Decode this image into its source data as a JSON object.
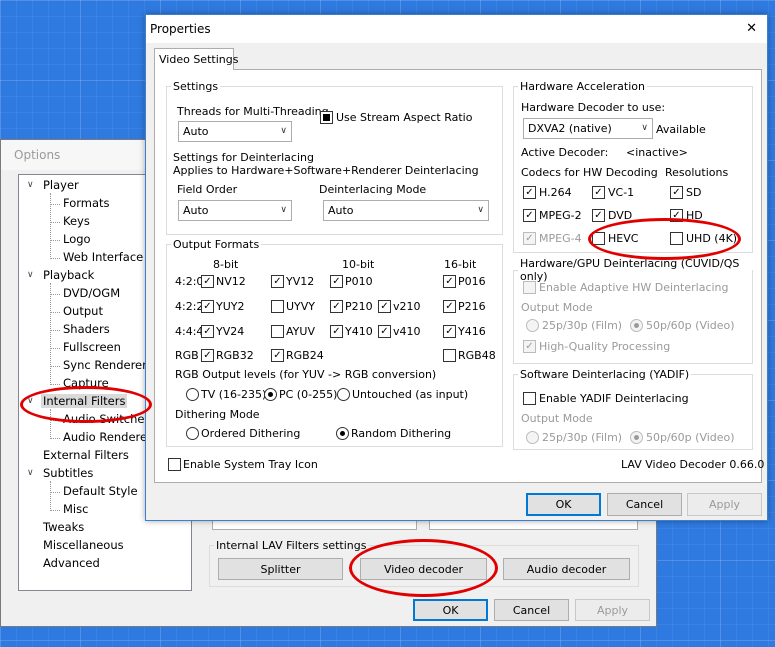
{
  "options": {
    "title": "Options",
    "tree": [
      {
        "label": "Player",
        "level": 0,
        "toggle": "∨"
      },
      {
        "label": "Formats",
        "level": 1
      },
      {
        "label": "Keys",
        "level": 1
      },
      {
        "label": "Logo",
        "level": 1
      },
      {
        "label": "Web Interface",
        "level": 1
      },
      {
        "label": "Playback",
        "level": 0,
        "toggle": "∨"
      },
      {
        "label": "DVD/OGM",
        "level": 1
      },
      {
        "label": "Output",
        "level": 1
      },
      {
        "label": "Shaders",
        "level": 1
      },
      {
        "label": "Fullscreen",
        "level": 1
      },
      {
        "label": "Sync Renderer S",
        "level": 1
      },
      {
        "label": "Capture",
        "level": 1
      },
      {
        "label": "Internal Filters",
        "level": 0,
        "toggle": "∨",
        "selected": true
      },
      {
        "label": "Audio Switcher",
        "level": 1
      },
      {
        "label": "Audio Renderer",
        "level": 1
      },
      {
        "label": "External Filters",
        "level": 0
      },
      {
        "label": "Subtitles",
        "level": 0,
        "toggle": "∨"
      },
      {
        "label": "Default Style",
        "level": 1
      },
      {
        "label": "Misc",
        "level": 1
      },
      {
        "label": "Tweaks",
        "level": 0
      },
      {
        "label": "Miscellaneous",
        "level": 0
      },
      {
        "label": "Advanced",
        "level": 0
      }
    ],
    "lav_group": "Internal LAV Filters settings",
    "splitter_label": "Splitter",
    "video_decoder_label": "Video decoder",
    "audio_decoder_label": "Audio decoder",
    "ok_label": "OK",
    "cancel_label": "Cancel",
    "apply_label": "Apply"
  },
  "props": {
    "title": "Properties",
    "close_glyph": "✕",
    "tab_label": "Video Settings",
    "settings": {
      "legend": "Settings",
      "threads_label": "Threads for Multi-Threading",
      "threads_value": "Auto",
      "stream_aspect_label": "Use Stream Aspect Ratio",
      "deint_line1": "Settings for Deinterlacing",
      "deint_line2": "Applies to Hardware+Software+Renderer Deinterlacing",
      "field_order_label": "Field Order",
      "field_order_value": "Auto",
      "deint_mode_label": "Deinterlacing Mode",
      "deint_mode_value": "Auto"
    },
    "output": {
      "legend": "Output Formats",
      "headers": {
        "b8": "8-bit",
        "b10": "10-bit",
        "b16": "16-bit"
      },
      "rows": [
        {
          "label": "4:2:0",
          "items": [
            {
              "text": "NV12",
              "checked": true
            },
            {
              "text": "YV12",
              "checked": true
            },
            {
              "text": "P010",
              "checked": true
            },
            {
              "text": "",
              "checked": false,
              "hidden": true
            },
            {
              "text": "P016",
              "checked": true
            }
          ]
        },
        {
          "label": "4:2:2",
          "items": [
            {
              "text": "YUY2",
              "checked": true
            },
            {
              "text": "UYVY",
              "checked": false
            },
            {
              "text": "P210",
              "checked": true
            },
            {
              "text": "v210",
              "checked": true
            },
            {
              "text": "P216",
              "checked": true
            }
          ]
        },
        {
          "label": "4:4:4",
          "items": [
            {
              "text": "YV24",
              "checked": true
            },
            {
              "text": "AYUV",
              "checked": false
            },
            {
              "text": "Y410",
              "checked": true
            },
            {
              "text": "v410",
              "checked": true
            },
            {
              "text": "Y416",
              "checked": true
            }
          ]
        },
        {
          "label": "RGB",
          "items": [
            {
              "text": "RGB32",
              "checked": true
            },
            {
              "text": "RGB24",
              "checked": true
            },
            {
              "text": "",
              "checked": false,
              "hidden": true
            },
            {
              "text": "",
              "checked": false,
              "hidden": true
            },
            {
              "text": "RGB48",
              "checked": false
            }
          ]
        }
      ],
      "rgb_levels_label": "RGB Output levels (for YUV -> RGB conversion)",
      "rgb_tv": "TV (16-235)",
      "rgb_pc": "PC (0-255)",
      "rgb_untouched": "Untouched (as input)",
      "dither_label": "Dithering Mode",
      "dither_ordered": "Ordered Dithering",
      "dither_random": "Random Dithering"
    },
    "tray_label": "Enable System Tray Icon",
    "version": "LAV Video Decoder 0.66.0",
    "hw": {
      "legend": "Hardware Acceleration",
      "decoder_label": "Hardware Decoder to use:",
      "decoder_value": "DXVA2 (native)",
      "status": "Available",
      "active_label": "Active Decoder:",
      "active_value": "<inactive>",
      "codecs_label": "Codecs for HW Decoding",
      "res_label": "Resolutions",
      "codecs": [
        {
          "text": "H.264",
          "checked": true,
          "disabled": false
        },
        {
          "text": "VC-1",
          "checked": true,
          "disabled": false
        },
        {
          "text": "MPEG-2",
          "checked": true,
          "disabled": false
        },
        {
          "text": "DVD",
          "checked": true,
          "disabled": false
        },
        {
          "text": "MPEG-4",
          "checked": true,
          "disabled": true
        },
        {
          "text": "HEVC",
          "checked": false,
          "disabled": false
        }
      ],
      "resolutions": [
        {
          "text": "SD",
          "checked": true
        },
        {
          "text": "HD",
          "checked": true
        },
        {
          "text": "UHD (4K)",
          "checked": false
        }
      ]
    },
    "hwdeint": {
      "legend": "Hardware/GPU Deinterlacing (CUVID/QS only)",
      "enable_label": "Enable Adaptive HW Deinterlacing",
      "output_mode": "Output Mode",
      "opt1": "25p/30p (Film)",
      "opt2": "50p/60p (Video)",
      "hq_label": "High-Quality Processing"
    },
    "swdeint": {
      "legend": "Software Deinterlacing (YADIF)",
      "enable_label": "Enable YADIF Deinterlacing",
      "output_mode": "Output Mode",
      "opt1": "25p/30p (Film)",
      "opt2": "50p/60p (Video)"
    },
    "ok_label": "OK",
    "cancel_label": "Cancel",
    "apply_label": "Apply"
  }
}
